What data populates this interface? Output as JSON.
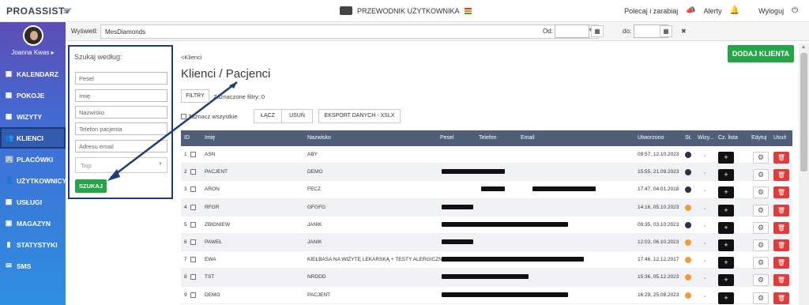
{
  "top": {
    "logo": "PROASSIST",
    "guide_label": "PRZEWODNIK UŻYTKOWNIKA",
    "refer_label": "Polecaj i zarabiaj",
    "alerts_label": "Alerty",
    "logout_label": "Wyloguj"
  },
  "sidebar": {
    "user": "Joanna Kwas ▸",
    "items": [
      {
        "label": "KALENDARZ",
        "icon": "calendar-icon"
      },
      {
        "label": "POKOJE",
        "icon": "calendar-icon"
      },
      {
        "label": "WIZYTY",
        "icon": "calendar-icon"
      },
      {
        "label": "KLIENCI",
        "icon": "users-icon"
      },
      {
        "label": "PLACÓWKI",
        "icon": "building-icon"
      },
      {
        "label": "UŻYTKOWNICY",
        "icon": "user-icon"
      },
      {
        "label": "USŁUGI",
        "icon": "grid-icon"
      },
      {
        "label": "MAGAZYN",
        "icon": "box-icon"
      },
      {
        "label": "STATYSTYKI",
        "icon": "chart-icon"
      },
      {
        "label": "SMS",
        "icon": "message-icon"
      }
    ],
    "active": "KLIENCI"
  },
  "filterbar": {
    "label": "Wyświetl:",
    "selected": "MesDiamonds",
    "od": "Od:",
    "do": "do:"
  },
  "search": {
    "title": "Szukaj według:",
    "pesel": "Pesel",
    "imie": "Imię",
    "nazwisko": "Nazwisko",
    "telefon": "Telefon pacjenta",
    "email": "Adresu email",
    "tagi": "Tagi",
    "button": "SZUKAJ"
  },
  "main": {
    "breadcrumb": "<Klienci",
    "title": "Klienci / Pacjenci",
    "add_button": "DODAJ KLIENTA",
    "filters_button": "FILTRY",
    "filters_count": "Zaznaczone filtry: 0",
    "select_all": "Zaznacz wszystkie",
    "merge": "ŁĄCZ",
    "delete": "USUŃ",
    "export": "EKSPORT DANYCH - XSLX"
  },
  "table": {
    "headers": {
      "id": "ID",
      "imie": "Imię",
      "nazwisko": "Nazwisko",
      "pesel": "Pesel",
      "telefon": "Telefon",
      "email": "Email",
      "utworzono": "Utworzono",
      "st": "St.",
      "wizyty": "Wizy...",
      "cz": "Cz. lista",
      "edytuj": "Edytuj",
      "usun": "Usuń"
    },
    "rows": [
      {
        "id": "1",
        "imie": "ASN",
        "nazwisko": "ABY",
        "created": "09:57, 12.10.2023",
        "status": "#2c3344"
      },
      {
        "id": "2",
        "imie": "PACJENT",
        "nazwisko": "DEMO",
        "created": "15:55, 21.09.2023",
        "status": "#2c3344"
      },
      {
        "id": "3",
        "imie": "ARON",
        "nazwisko": "FECZ",
        "created": "17:47, 04.01.2018",
        "status": "#2c3344"
      },
      {
        "id": "4",
        "imie": "RFGR",
        "nazwisko": "GFGFG",
        "created": "14:16, 05.10.2023",
        "status": "#f39b3a"
      },
      {
        "id": "5",
        "imie": "ZBIGNIEW",
        "nazwisko": "JANIK",
        "created": "09:35, 03.10.2023",
        "status": "#2c3344"
      },
      {
        "id": "6",
        "imie": "PAWEŁ",
        "nazwisko": "JANIK",
        "created": "12:03, 06.10.2023",
        "status": "#f39b3a"
      },
      {
        "id": "7",
        "imie": "EWA",
        "nazwisko": "KIEŁBASA NA WIZYTĘ LEKARSKĄ + TESTY ALERGICZNE",
        "created": "17:46, 12.12.2017",
        "status": "#f39b3a"
      },
      {
        "id": "8",
        "imie": "TST",
        "nazwisko": "NRDDD",
        "created": "15:36, 05.12.2023",
        "status": "#f39b3a"
      },
      {
        "id": "9",
        "imie": "DEMO",
        "nazwisko": "PACJENT",
        "created": "16:29, 25.08.2023",
        "status": "#f39b3a"
      }
    ]
  }
}
